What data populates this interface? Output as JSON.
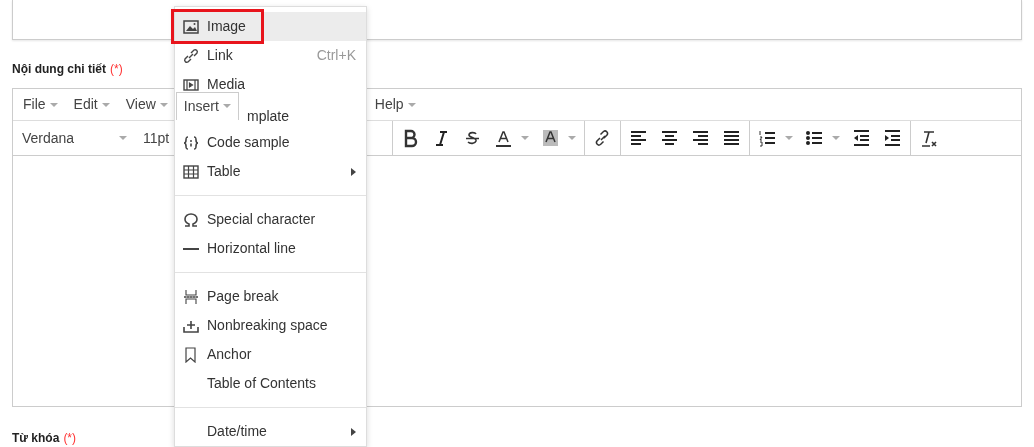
{
  "content_label": {
    "text": "Nội dung chi tiết",
    "required": "(*)"
  },
  "editor": {
    "menubar": [
      {
        "label": "File",
        "open": false
      },
      {
        "label": "Edit",
        "open": false
      },
      {
        "label": "View",
        "open": false
      },
      {
        "label": "Insert",
        "open": true
      },
      {
        "label": "Help",
        "open": false
      }
    ],
    "font_family": "Verdana",
    "font_size": "11pt",
    "toolbar": [
      {
        "kind": "bold"
      },
      {
        "kind": "italic"
      },
      {
        "kind": "strike"
      },
      {
        "kind": "forecolor"
      },
      {
        "kind": "backcolor"
      },
      {
        "kind": "sep"
      },
      {
        "kind": "link"
      },
      {
        "kind": "sep"
      },
      {
        "kind": "align-left"
      },
      {
        "kind": "align-center"
      },
      {
        "kind": "align-right"
      },
      {
        "kind": "justify"
      },
      {
        "kind": "sep"
      },
      {
        "kind": "numlist"
      },
      {
        "kind": "bullist"
      },
      {
        "kind": "outdent"
      },
      {
        "kind": "indent"
      },
      {
        "kind": "sep"
      },
      {
        "kind": "clear-format"
      }
    ]
  },
  "insert_menu": [
    {
      "kind": "image",
      "label": "Image",
      "selected": true,
      "outlined": true
    },
    {
      "kind": "link",
      "label": "Link",
      "shortcut": "Ctrl+K",
      "selected": false
    },
    {
      "kind": "media",
      "label": "Media",
      "selected": false
    },
    {
      "kind": "covered",
      "label": "mplate",
      "selected": false
    },
    {
      "kind": "code",
      "label": "Code sample",
      "selected": false
    },
    {
      "kind": "table",
      "label": "Table",
      "submenu": true,
      "selected": false
    },
    {
      "kind": "separator"
    },
    {
      "kind": "omega",
      "label": "Special character",
      "selected": false
    },
    {
      "kind": "hr",
      "label": "Horizontal line",
      "selected": false
    },
    {
      "kind": "separator"
    },
    {
      "kind": "pagebreak",
      "label": "Page break",
      "selected": false
    },
    {
      "kind": "nbsp",
      "label": "Nonbreaking space",
      "selected": false
    },
    {
      "kind": "anchor",
      "label": "Anchor",
      "selected": false
    },
    {
      "kind": "plain",
      "label": "Table of Contents",
      "selected": false
    },
    {
      "kind": "separator"
    },
    {
      "kind": "plain",
      "label": "Date/time",
      "submenu": true,
      "selected": false
    }
  ],
  "keyword_label": {
    "text": "Từ khóa",
    "required": "(*)"
  }
}
